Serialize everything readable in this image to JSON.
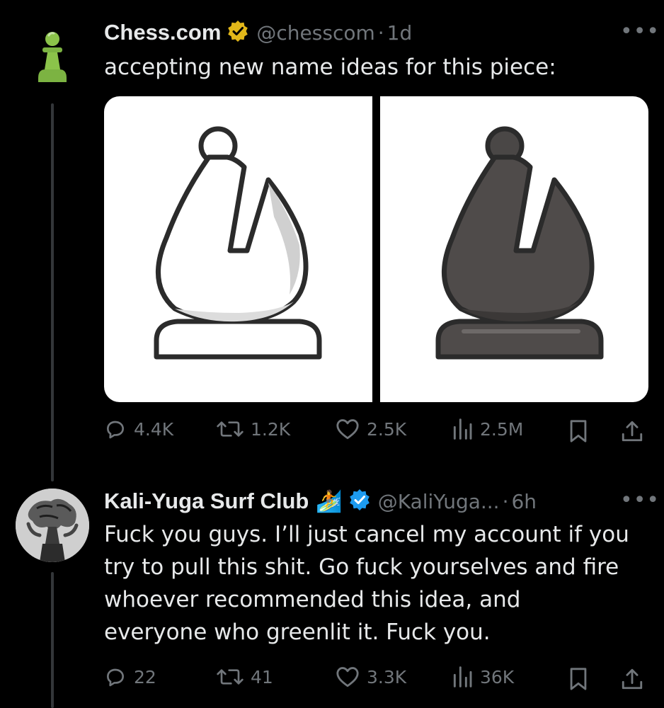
{
  "tweet1": {
    "display_name": "Chess.com",
    "handle": "@chesscom",
    "separator": "·",
    "time": "1d",
    "text": "accepting new name ideas for this piece:",
    "verified_color": "#e2b719",
    "avatar_icon": "green-pawn-icon",
    "media": [
      "white-bishop-icon",
      "black-bishop-icon"
    ],
    "actions": {
      "replies": "4.4K",
      "reposts": "1.2K",
      "likes": "2.5K",
      "views": "2.5M"
    }
  },
  "tweet2": {
    "display_name": "Kali-Yuga Surf Club",
    "emoji": "🏄",
    "handle": "@KaliYuga...",
    "separator": "·",
    "time": "6h",
    "text_lines": [
      "Fuck you guys. I’ll just cancel my account if you",
      "try to pull this shit. Go fuck yourselves and fire",
      "whoever recommended this idea, and",
      "everyone who greenlit it. Fuck you."
    ],
    "verified_color": "#1d9bf0",
    "actions": {
      "replies": "22",
      "reposts": "41",
      "likes": "3.3K",
      "views": "36K"
    }
  },
  "colors": {
    "background": "#000000",
    "text": "#e7e9ea",
    "muted": "#71767b",
    "thread_line": "#333639"
  }
}
